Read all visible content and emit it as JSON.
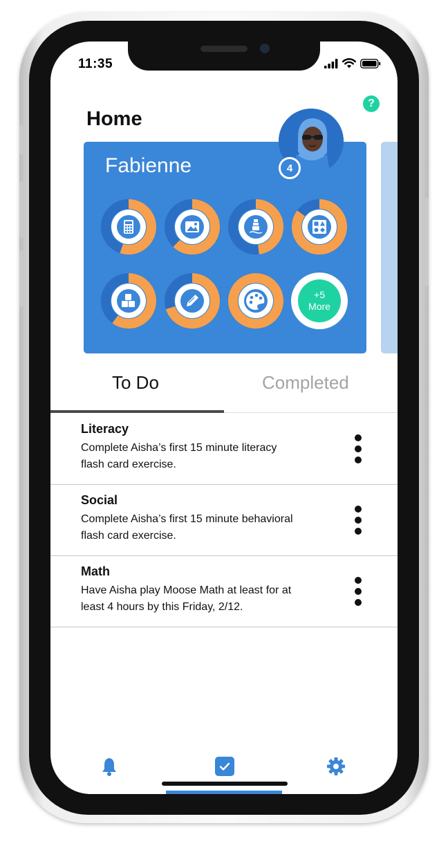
{
  "status_bar": {
    "time": "11:35"
  },
  "page": {
    "title": "Home",
    "help_label": "?"
  },
  "child_card": {
    "name": "Fabienne",
    "badge_count": "4",
    "apps": [
      {
        "icon": "calculator-icon",
        "progress": 0.55
      },
      {
        "icon": "image-icon",
        "progress": 0.62
      },
      {
        "icon": "lighthouse-icon",
        "progress": 0.48
      },
      {
        "icon": "shapes-icon",
        "progress": 0.85
      },
      {
        "icon": "blocks-icon",
        "progress": 0.6
      },
      {
        "icon": "pencil-icon",
        "progress": 0.7
      },
      {
        "icon": "palette-icon",
        "progress": 1.0
      }
    ],
    "more": {
      "count_label": "+5",
      "label": "More"
    }
  },
  "tabs": {
    "todo": "To Do",
    "completed": "Completed"
  },
  "tasks": [
    {
      "title": "Literacy",
      "desc_line1": "Complete Aisha’s first 15 minute literacy",
      "desc_line2": "flash card exercise."
    },
    {
      "title": "Social",
      "desc_line1": "Complete Aisha’s first 15 minute behavioral",
      "desc_line2": "flash card exercise."
    },
    {
      "title": "Math",
      "desc_line1": "Have Aisha play Moose Math at least for at",
      "desc_line2": "least 4 hours by this Friday, 2/12."
    }
  ],
  "tab_bar": {
    "items": [
      "bell-icon",
      "checklist-icon",
      "gear-icon"
    ],
    "active": "checklist-icon"
  },
  "colors": {
    "brand_blue": "#3a86d8",
    "progress_orange": "#f6a04d",
    "accent_green": "#1fd2a2"
  }
}
